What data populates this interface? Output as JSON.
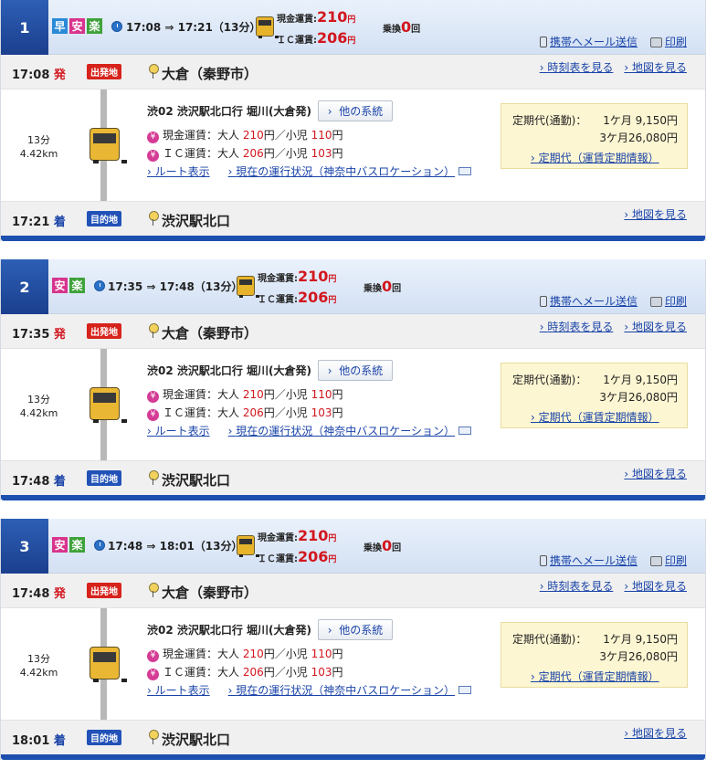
{
  "header_links": {
    "mail": "携帯へメール送信",
    "print": "印刷"
  },
  "stop_links": {
    "timetable": "時刻表を見る",
    "map": "地図を見る"
  },
  "labels": {
    "cash_fare": "現金運賃:",
    "ic_fare": "ＩＣ運賃:",
    "yen": "円",
    "transfer": "乗換",
    "transfer_unit": "回",
    "dep_suffix": "発",
    "arr_suffix": "着",
    "dep_tag": "出発地",
    "arr_tag": "目的地",
    "other_routes": "他の系統",
    "cash_line_prefix": "現金運賃：大人 ",
    "ic_line_prefix": "ＩＣ運賃：大人 ",
    "yen_slash_child": "円／小児 ",
    "route_link": "ルート表示",
    "status_link": "現在の運行状況（神奈中バスロケーション）",
    "teiki_label": "定期代(通勤)：",
    "teiki_link": "定期代（運賃定期情報）"
  },
  "routes": [
    {
      "number": "1",
      "badges": [
        "早",
        "安",
        "楽"
      ],
      "time_range": "17:08 ⇒ 17:21（13分）",
      "cash_fare": "210",
      "ic_fare": "206",
      "transfers": "0",
      "dep_time": "17:08",
      "dep_name": "大倉（秦野市）",
      "arr_time": "17:21",
      "arr_name": "渋沢駅北口",
      "duration": "13分",
      "distance": "4.42km",
      "line": "渋02 渋沢駅北口行 堀川(大倉発)",
      "adult_cash": "210",
      "child_cash": "110",
      "adult_ic": "206",
      "child_ic": "103",
      "teiki_1m": "1ケ月  9,150円",
      "teiki_3m": "3ケ月26,080円"
    },
    {
      "number": "2",
      "badges": [
        "安",
        "楽"
      ],
      "time_range": "17:35 ⇒ 17:48（13分）",
      "cash_fare": "210",
      "ic_fare": "206",
      "transfers": "0",
      "dep_time": "17:35",
      "dep_name": "大倉（秦野市）",
      "arr_time": "17:48",
      "arr_name": "渋沢駅北口",
      "duration": "13分",
      "distance": "4.42km",
      "line": "渋02 渋沢駅北口行 堀川(大倉発)",
      "adult_cash": "210",
      "child_cash": "110",
      "adult_ic": "206",
      "child_ic": "103",
      "teiki_1m": "1ケ月  9,150円",
      "teiki_3m": "3ケ月26,080円"
    },
    {
      "number": "3",
      "badges": [
        "安",
        "楽"
      ],
      "time_range": "17:48 ⇒ 18:01（13分）",
      "cash_fare": "210",
      "ic_fare": "206",
      "transfers": "0",
      "dep_time": "17:48",
      "dep_name": "大倉（秦野市）",
      "arr_time": "18:01",
      "arr_name": "渋沢駅北口",
      "duration": "13分",
      "distance": "4.42km",
      "line": "渋02 渋沢駅北口行 堀川(大倉発)",
      "adult_cash": "210",
      "child_cash": "110",
      "adult_ic": "206",
      "child_ic": "103",
      "teiki_1m": "1ケ月  9,150円",
      "teiki_3m": "3ケ月26,080円"
    }
  ],
  "colors": {
    "accent_blue": "#1d4fae",
    "fare_red": "#d2161e",
    "haya": "#2a8ad6",
    "an": "#d8348d",
    "raku": "#3ea23a"
  }
}
